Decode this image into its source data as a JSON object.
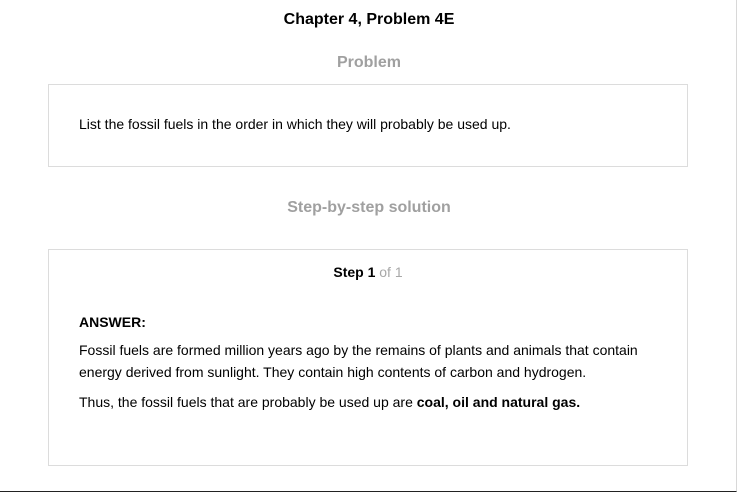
{
  "header": {
    "title": "Chapter 4, Problem 4E"
  },
  "problem": {
    "heading": "Problem",
    "text": "List the fossil fuels in the order in which they will probably be used up."
  },
  "solution": {
    "heading": "Step-by-step solution",
    "step_word": "Step 1",
    "step_of": " of 1",
    "answer_label": "ANSWER:",
    "paragraph1": "Fossil fuels are formed million years ago by the remains of plants and animals that contain energy derived from sunlight. They contain high contents of carbon and hydrogen.",
    "paragraph2_prefix": "Thus, the fossil fuels that are probably be used up are ",
    "paragraph2_bold": "coal, oil and natural gas."
  }
}
